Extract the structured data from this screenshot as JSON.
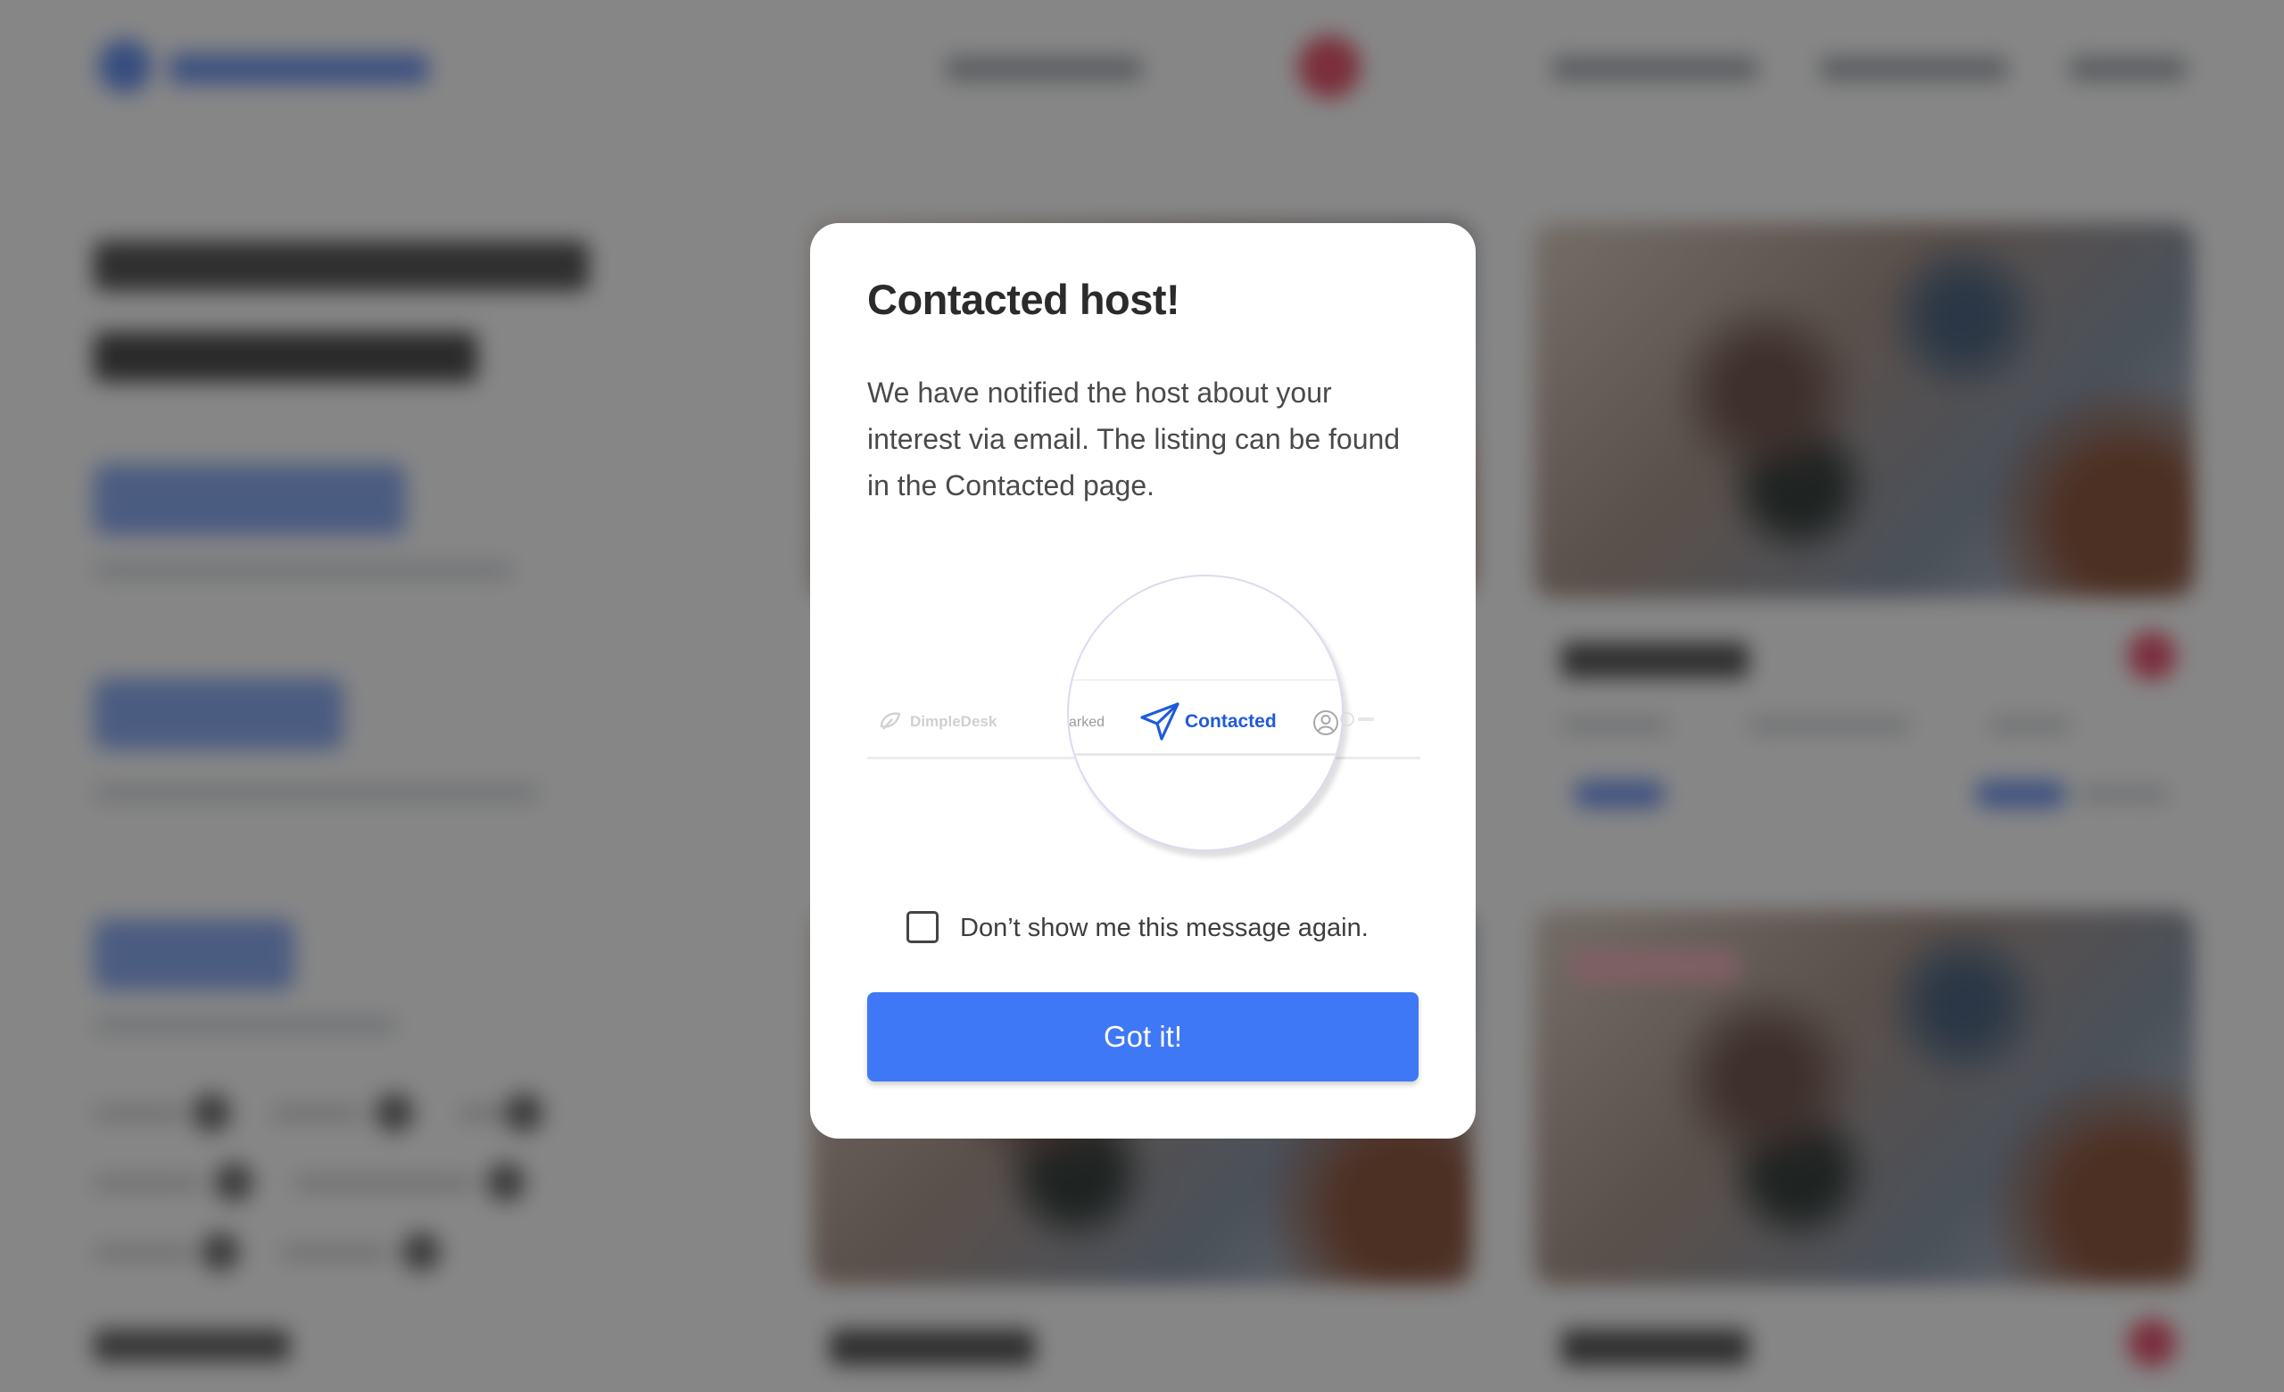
{
  "modal": {
    "title": "Contacted host!",
    "body": "We have notified the host about your interest via email. The listing can be found in the Contacted page.",
    "illustration": {
      "brand": "DimpleDesk",
      "partial_tab": "arked",
      "active_tab": "Contacted",
      "active_tab_icon": "paper-plane-icon",
      "next_tab_icon": "profile-icon",
      "accent_color": "#1f5bdb"
    },
    "checkbox_label": "Don’t show me this message again.",
    "checkbox_checked": false,
    "button_label": "Got it!",
    "button_color": "#3f78f6"
  },
  "background": {
    "overlay_color": "rgba(40,40,40,0.56)",
    "brand_color": "#4d7ff0",
    "favorite_color": "#e8385a"
  }
}
